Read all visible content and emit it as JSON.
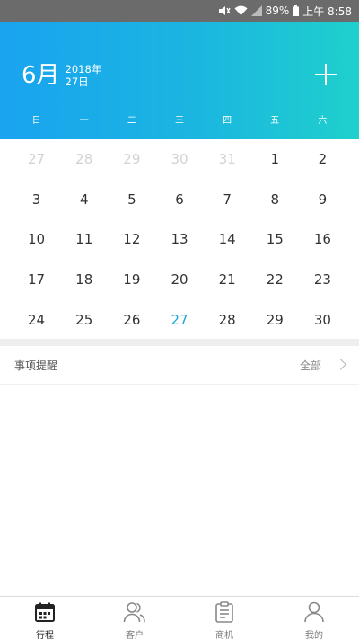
{
  "status_bar": {
    "battery": "89%",
    "time": "上午 8:58"
  },
  "header": {
    "month": "6月",
    "year": "2018年",
    "day": "27日"
  },
  "weekdays": [
    "日",
    "一",
    "二",
    "三",
    "四",
    "五",
    "六"
  ],
  "calendar": {
    "weeks": [
      [
        {
          "d": "27",
          "s": "muted"
        },
        {
          "d": "28",
          "s": "muted"
        },
        {
          "d": "29",
          "s": "muted"
        },
        {
          "d": "30",
          "s": "muted"
        },
        {
          "d": "31",
          "s": "muted"
        },
        {
          "d": "1",
          "s": ""
        },
        {
          "d": "2",
          "s": ""
        }
      ],
      [
        {
          "d": "3",
          "s": ""
        },
        {
          "d": "4",
          "s": ""
        },
        {
          "d": "5",
          "s": ""
        },
        {
          "d": "6",
          "s": ""
        },
        {
          "d": "7",
          "s": ""
        },
        {
          "d": "8",
          "s": ""
        },
        {
          "d": "9",
          "s": ""
        }
      ],
      [
        {
          "d": "10",
          "s": ""
        },
        {
          "d": "11",
          "s": ""
        },
        {
          "d": "12",
          "s": ""
        },
        {
          "d": "13",
          "s": ""
        },
        {
          "d": "14",
          "s": ""
        },
        {
          "d": "15",
          "s": ""
        },
        {
          "d": "16",
          "s": ""
        }
      ],
      [
        {
          "d": "17",
          "s": ""
        },
        {
          "d": "18",
          "s": ""
        },
        {
          "d": "19",
          "s": ""
        },
        {
          "d": "20",
          "s": ""
        },
        {
          "d": "21",
          "s": ""
        },
        {
          "d": "22",
          "s": ""
        },
        {
          "d": "23",
          "s": ""
        }
      ],
      [
        {
          "d": "24",
          "s": ""
        },
        {
          "d": "25",
          "s": ""
        },
        {
          "d": "26",
          "s": ""
        },
        {
          "d": "27",
          "s": "today"
        },
        {
          "d": "28",
          "s": ""
        },
        {
          "d": "29",
          "s": ""
        },
        {
          "d": "30",
          "s": ""
        }
      ]
    ]
  },
  "reminder": {
    "title": "事项提醒",
    "all": "全部"
  },
  "tabs": [
    {
      "label": "行程",
      "icon": "calendar-icon",
      "active": true
    },
    {
      "label": "客户",
      "icon": "customers-icon",
      "active": false
    },
    {
      "label": "商机",
      "icon": "clipboard-icon",
      "active": false
    },
    {
      "label": "我的",
      "icon": "profile-icon",
      "active": false
    }
  ],
  "colors": {
    "header_start": "#1aa3f0",
    "header_end": "#1fd0cd",
    "today": "#1ba8d8",
    "muted": "#d2d2d2"
  }
}
